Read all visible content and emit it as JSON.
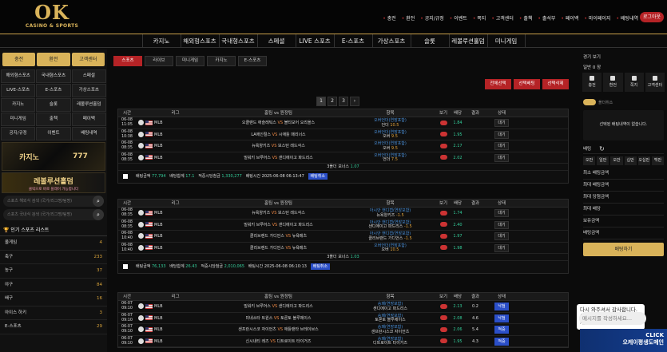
{
  "header": {
    "logo": "OK",
    "logo_sub": "CASINO & SPORTS",
    "menu": [
      "충전",
      "환전",
      "공지/규정",
      "이벤트",
      "쪽지",
      "고객센터",
      "출첵",
      "출석부",
      "페이백",
      "마이페이지",
      "배팅내역"
    ],
    "logout": "로그아웃"
  },
  "nav": [
    "카지노",
    "해외형스포츠",
    "국내형스포츠",
    "스페셜",
    "LIVE 스포츠",
    "E-스포츠",
    "가상스포츠",
    "슬롯",
    "레볼루션홀덤",
    "미니게임"
  ],
  "left": {
    "buttons": [
      "충전",
      "환전",
      "고객센터"
    ],
    "grid": [
      "해외형스포츠",
      "국내형스포츠",
      "스페셜",
      "LIVE-스포츠",
      "E-스포츠",
      "가상스포츠",
      "카지노",
      "슬롯",
      "레볼루션홀덤",
      "미니게임",
      "출첵",
      "페이백",
      "공지/규정",
      "이벤트",
      "배팅내역"
    ],
    "banner1": "카지노",
    "banner1b": "777",
    "banner2": "레볼루션홀덤",
    "banner2_sub": "클릭으로 바로 플레이 가능합니다",
    "search1": "스포츠 해외식 검색 (국가/리그명/팀명)",
    "search2": "스포츠 국내식 검색 (국가/리그명/팀명)",
    "list_title": "인기 스포츠 리스트",
    "sports": [
      {
        "name": "올게임",
        "count": "4"
      },
      {
        "name": "축구",
        "count": "233"
      },
      {
        "name": "농구",
        "count": "37"
      },
      {
        "name": "야구",
        "count": "84"
      },
      {
        "name": "배구",
        "count": "16"
      },
      {
        "name": "아이스 하키",
        "count": "3"
      },
      {
        "name": "E-스포츠",
        "count": "29"
      }
    ]
  },
  "main": {
    "tabs": [
      "스포츠",
      "라이브",
      "미니게임",
      "카지노",
      "E-스포츠"
    ],
    "actions": [
      "전체선택",
      "선택배팅",
      "선택삭제"
    ],
    "pages": [
      "1",
      "2",
      "3",
      "›"
    ],
    "cols": [
      "시간",
      "리그",
      "홈팀 vs 원정팀",
      "항목",
      "보기",
      "배당",
      "결과",
      "상태"
    ],
    "groups": [
      {
        "rows": [
          {
            "date": "06-08",
            "time": "11:05",
            "league": "MLB",
            "home": "오클랜드 애슬레틱스",
            "away": "볼티모어 오리올스",
            "o1": "오버언더(연장포함)",
            "o2": "언더",
            "o2v": "10.5",
            "odds": "1.84",
            "status": "대기"
          },
          {
            "date": "06-08",
            "time": "10:38",
            "league": "MLB",
            "home": "LA에인절스",
            "away": "시애틀 매리너스",
            "o1": "오버언더(연장포함)",
            "o2": "오버",
            "o2v": "9.5",
            "odds": "1.95",
            "status": "대기"
          },
          {
            "date": "06-08",
            "time": "08:35",
            "league": "MLB",
            "home": "뉴욕양키즈",
            "away": "보스턴 레드삭스",
            "o1": "오버언더(연장포함)",
            "o2": "오버",
            "o2v": "9.5",
            "odds": "2.17",
            "status": "대기"
          },
          {
            "date": "06-08",
            "time": "08:35",
            "league": "MLB",
            "home": "밀워키 브루어스",
            "away": "샌디에이고 파드리스",
            "o1": "오버언더(연장포함)",
            "o2": "언더",
            "o2v": "7.5",
            "odds": "2.02",
            "status": "대기"
          }
        ],
        "folder": "3폴더 보너스",
        "folder_v": "1.07",
        "bet": "배팅금액",
        "bet_amt": "77,794",
        "odds_label": "배당합계",
        "odds_v": "17.1",
        "win_label": "적중시당첨금",
        "win_v": "1,330,277",
        "time_label": "배팅시간",
        "time_v": "2025-06-08 06:13:47",
        "cancel": "배팅취소"
      },
      {
        "rows": [
          {
            "date": "06-08",
            "time": "08:35",
            "league": "MLB",
            "home": "뉴욕양키즈",
            "away": "보스턴 레드삭스",
            "o1": "아시안 핸디캡(연장포함)",
            "o2": "뉴욕양키즈",
            "o2v": "-1.5",
            "odds": "1.74",
            "status": "대기"
          },
          {
            "date": "06-08",
            "time": "08:35",
            "league": "MLB",
            "home": "밀워키 브루어스",
            "away": "샌디에이고 파드리스",
            "o1": "아시안 핸디캡(연장포함)",
            "o2": "샌디에이고 파드리스",
            "o2v": "-1.5",
            "odds": "2.40",
            "status": "대기"
          },
          {
            "date": "06-08",
            "time": "10:40",
            "league": "MLB",
            "home": "클리브랜드 가디언스",
            "away": "뉴욕메츠",
            "o1": "아시안 핸디캡(연장포함)",
            "o2": "클리브랜드 가디언스",
            "o2v": "-1.5",
            "odds": "1.97",
            "status": "대기"
          },
          {
            "date": "06-08",
            "time": "10:40",
            "league": "MLB",
            "home": "클리브랜드 가디언스",
            "away": "뉴욕메츠",
            "o1": "오버언더(연장포함)",
            "o2": "오버",
            "o2v": "10.5",
            "odds": "1.98",
            "status": "대기"
          }
        ],
        "folder": "3폴더 보너스",
        "folder_v": "1.03",
        "bet": "배팅금액",
        "bet_amt": "76,133",
        "odds_label": "배당합계",
        "odds_v": "26.43",
        "win_label": "적중시당첨금",
        "win_v": "2,010,065",
        "time_label": "배팅시간",
        "time_v": "2025-06-08 06:10:13",
        "cancel": "배팅취소"
      },
      {
        "rows": [
          {
            "date": "06-07",
            "time": "09:10",
            "league": "MLB",
            "home": "밀워키 브루어스",
            "away": "샌디에이고 파드리스",
            "o1": "승패(연장포함)",
            "o2": "샌디에이고 파드리스",
            "o2v": "",
            "odds": "2.13",
            "res": "0.2",
            "status": "낙첨"
          },
          {
            "date": "06-07",
            "time": "09:10",
            "league": "MLB",
            "home": "미네소타 트윈스",
            "away": "토론토 블루제이스",
            "o1": "승패(연장포함)",
            "o2": "토론토 블루제이스",
            "o2v": "",
            "odds": "2.08",
            "res": "4.6",
            "status": "낙첨"
          },
          {
            "date": "06-07",
            "time": "09:10",
            "league": "MLB",
            "home": "샌프란시스코 자이언츠",
            "away": "애틀랜타 브레이브스",
            "o1": "승패(연장포함)",
            "o2": "샌프란시스코 자이언츠",
            "o2v": "",
            "odds": "2.06",
            "res": "5.4",
            "status": "적중"
          },
          {
            "date": "06-07",
            "time": "09:10",
            "league": "MLB",
            "home": "신시내티 레즈",
            "away": "디트로이트 타이거즈",
            "o1": "승패(연장포함)",
            "o2": "디트로이트 타이거즈",
            "o2v": "",
            "odds": "1.95",
            "res": "4.3",
            "status": "적중"
          }
        ]
      }
    ]
  },
  "right": {
    "hdr": "경기 보기",
    "pick": "일반 0 장",
    "grid": [
      "충전",
      "환전",
      "쪽지",
      "고객센터"
    ],
    "toggle": "폴더취소",
    "empty": "선택된 배팅내역이 없습니다.",
    "betting": "배팅",
    "chips": [
      "오만",
      "일만",
      "오만",
      "십만",
      "오십만",
      "백만"
    ],
    "labels": [
      "최소 배팅금액",
      "최대 배팅금액",
      "최대 당첨금액",
      "최대 배당",
      "보유금액",
      "배팅금액"
    ],
    "bet_btn": "배팅하기",
    "chat": "다시 와주셔서 감사합니다. 궁금한 점이 있으면말씀해주세요.",
    "chat_input": "메시지를 작성하세요...",
    "click": "CLICK",
    "big": "오케이평생도메인",
    "big_sub": "OK"
  }
}
